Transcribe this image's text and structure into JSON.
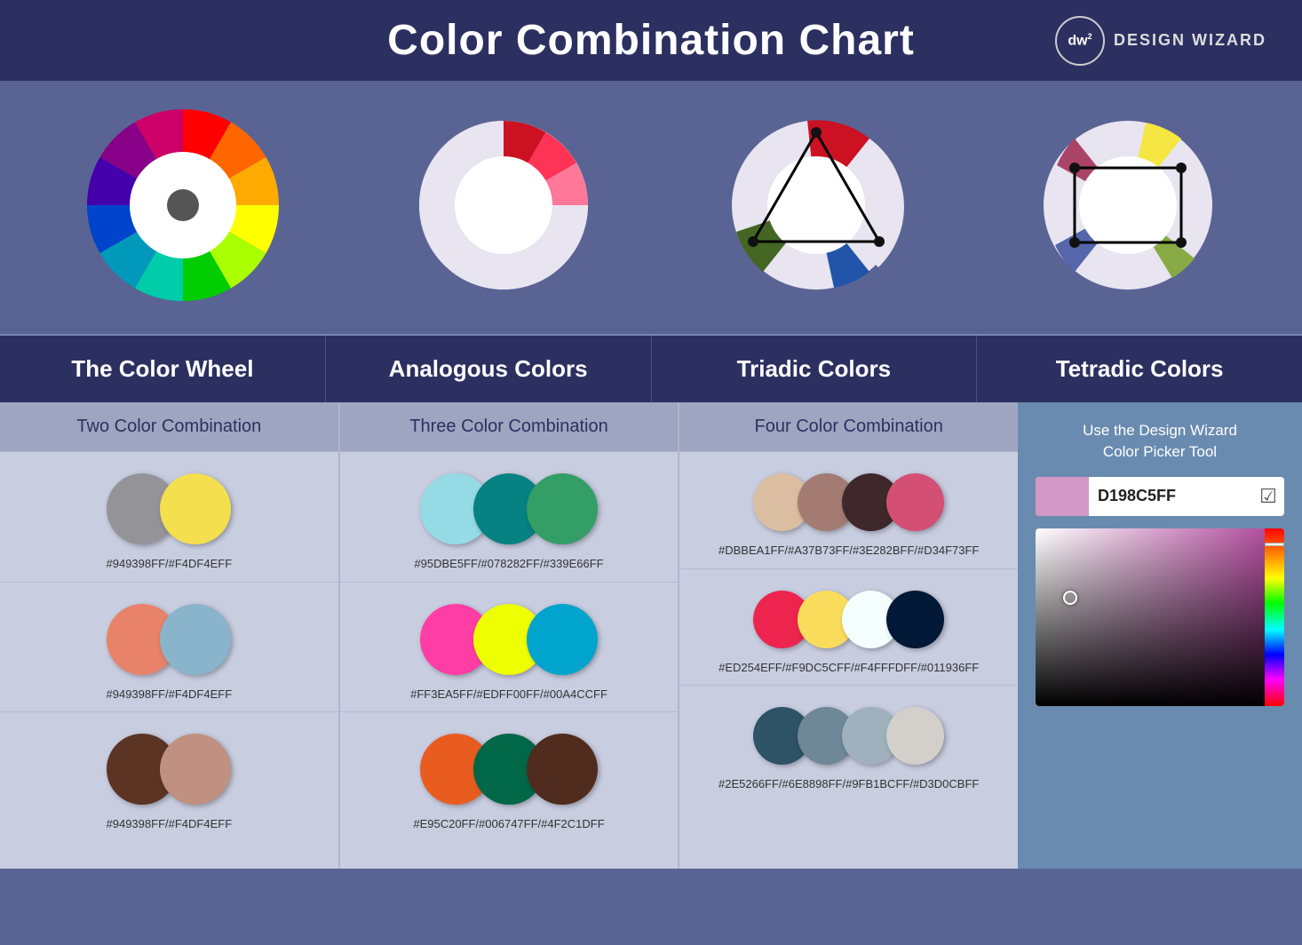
{
  "header": {
    "title": "Color Combination Chart",
    "logo_text": "dw",
    "logo_sup": "2",
    "brand_name": "DESIGN WIZARD"
  },
  "sections": [
    {
      "label": "The Color Wheel"
    },
    {
      "label": "Analogous Colors"
    },
    {
      "label": "Triadic Colors"
    },
    {
      "label": "Tetradic Colors"
    }
  ],
  "col_headers": [
    "Two Color Combination",
    "Three Color Combination",
    "Four Color Combination"
  ],
  "two_color_combos": [
    {
      "circles": [
        "#949398",
        "#F4DF4E"
      ],
      "code": "#949398FF/#F4DF4EFF"
    },
    {
      "circles": [
        "#E8836A",
        "#8AB4CC"
      ],
      "code": "#949398FF/#F4DF4EFF"
    },
    {
      "circles": [
        "#5C3424",
        "#C09080"
      ],
      "code": "#949398FF/#F4DF4EFF"
    }
  ],
  "three_color_combos": [
    {
      "circles": [
        "#95DBE5",
        "#078282",
        "#339E66"
      ],
      "code": "#95DBE5FF/#078282FF/#339E66FF"
    },
    {
      "circles": [
        "#FF3EA5",
        "#EDFF00",
        "#00A4CC"
      ],
      "code": "#FF3EA5FF/#EDFF00FF/#00A4CCFF"
    },
    {
      "circles": [
        "#E95C20",
        "#006747",
        "#4F2C1D"
      ],
      "code": "#E95C20FF/#006747FF/#4F2C1DFF"
    }
  ],
  "four_color_combos": [
    {
      "circles": [
        "#DBBEA1",
        "#A37B73",
        "#3E282B",
        "#D34F73"
      ],
      "code": "#DBBEA1FF/#A37B73FF/#3E282BFF/#D34F73FF"
    },
    {
      "circles": [
        "#ED254E",
        "#F9DC5C",
        "#F4FFFD",
        "#011936"
      ],
      "code": "#ED254EFF/#F9DC5CFF/#F4FFFDFF/#011936FF"
    },
    {
      "circles": [
        "#2E5266",
        "#6E8898",
        "#9FB1BC",
        "#D3D0CB"
      ],
      "code": "#2E5266FF/#6E8898FF/#9FB1BCFF/#D3D0CBFF"
    }
  ],
  "picker": {
    "label": "Use the Design Wizard\nColor Picker Tool",
    "hex_value": "D198C5FF",
    "swatch_color": "#d198c5"
  }
}
